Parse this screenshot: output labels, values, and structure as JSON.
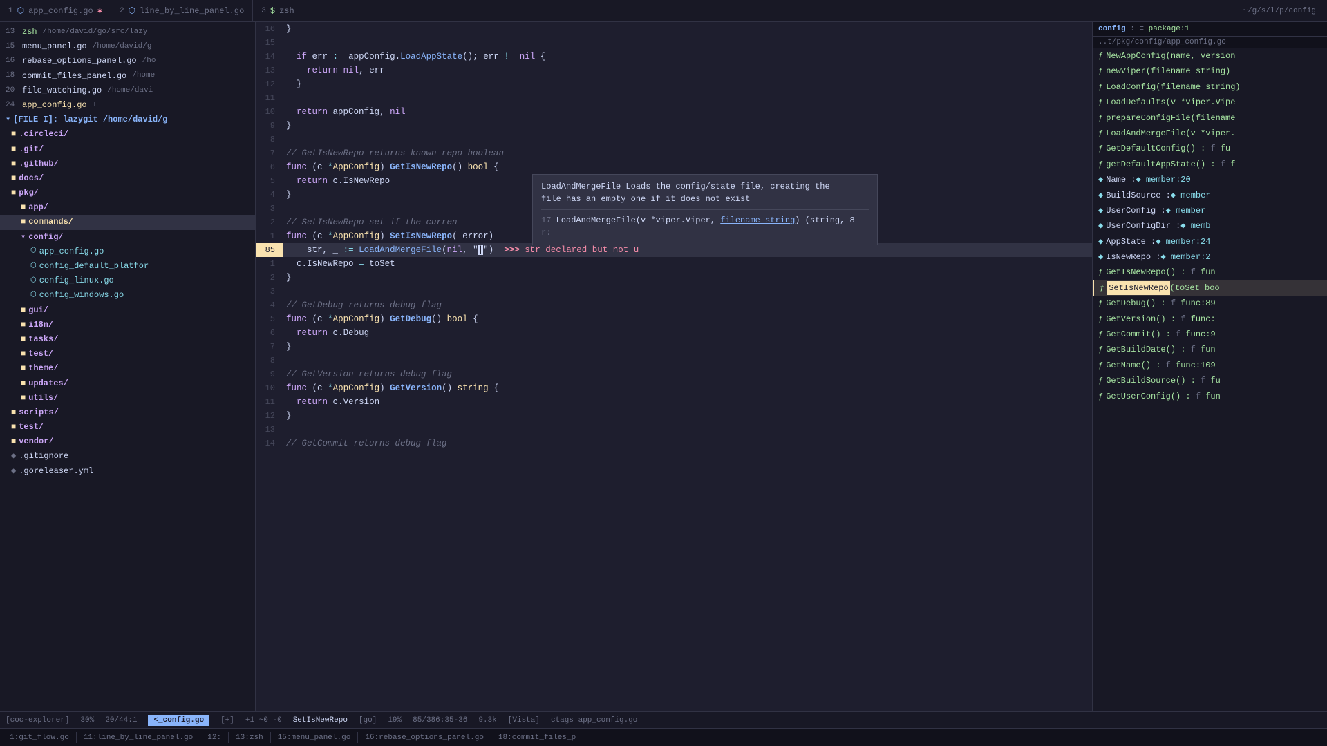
{
  "tabs": [
    {
      "num": "1",
      "icon": "go-file",
      "label": "app_config.go",
      "modified": true,
      "active": false
    },
    {
      "num": "2",
      "icon": "go-file",
      "label": "line_by_line_panel.go",
      "modified": false,
      "active": false
    },
    {
      "num": "3",
      "icon": "terminal",
      "label": "zsh",
      "modified": false,
      "active": false
    }
  ],
  "right_path": "~/g/s/l/p/config",
  "right_path2": "..t/pkg/config/app_config.go",
  "sidebar": {
    "header": "[FILE I]: lazygit /home/david/g",
    "items": [
      {
        "indent": 1,
        "type": "folder",
        "name": ".circleci/"
      },
      {
        "indent": 1,
        "type": "folder",
        "name": ".git/"
      },
      {
        "indent": 1,
        "type": "folder",
        "name": ".github/"
      },
      {
        "indent": 1,
        "type": "folder",
        "name": "docs/"
      },
      {
        "indent": 1,
        "type": "folder",
        "name": "pkg/"
      },
      {
        "indent": 2,
        "type": "folder",
        "name": "app/"
      },
      {
        "indent": 2,
        "type": "folder",
        "name": "commands/",
        "selected": true
      },
      {
        "indent": 2,
        "type": "folder-open",
        "name": "config/"
      },
      {
        "indent": 3,
        "type": "go-file",
        "name": "app_config.go"
      },
      {
        "indent": 3,
        "type": "go-file",
        "name": "config_default_platfor"
      },
      {
        "indent": 3,
        "type": "go-file",
        "name": "config_linux.go"
      },
      {
        "indent": 3,
        "type": "go-file",
        "name": "config_windows.go"
      },
      {
        "indent": 2,
        "type": "folder",
        "name": "gui/"
      },
      {
        "indent": 2,
        "type": "folder",
        "name": "i18n/"
      },
      {
        "indent": 2,
        "type": "folder",
        "name": "tasks/"
      },
      {
        "indent": 2,
        "type": "folder",
        "name": "test/"
      },
      {
        "indent": 2,
        "type": "folder",
        "name": "theme/"
      },
      {
        "indent": 2,
        "type": "folder",
        "name": "updates/"
      },
      {
        "indent": 2,
        "type": "folder",
        "name": "utils/"
      },
      {
        "indent": 1,
        "type": "folder",
        "name": "scripts/"
      },
      {
        "indent": 1,
        "type": "folder",
        "name": "test/"
      },
      {
        "indent": 1,
        "type": "folder",
        "name": "vendor/"
      },
      {
        "indent": 1,
        "type": "file",
        "name": ".gitignore"
      },
      {
        "indent": 1,
        "type": "file",
        "name": ".goreleaser.yml"
      }
    ],
    "file_list": [
      {
        "num": "13",
        "name": "zsh",
        "path": "/home/david/go/src/lazy"
      },
      {
        "num": "15",
        "name": "menu_panel.go",
        "path": "/home/david/g"
      },
      {
        "num": "16",
        "name": "rebase_options_panel.go",
        "path": "/ho"
      },
      {
        "num": "18",
        "name": "commit_files_panel.go",
        "path": "/home"
      },
      {
        "num": "20",
        "name": "file_watching.go",
        "path": "/home/davi"
      },
      {
        "num": "24",
        "name": "app_config.go",
        "path": "+"
      }
    ]
  },
  "code": {
    "lines": [
      {
        "num": "16",
        "content": "}"
      },
      {
        "num": "15",
        "content": ""
      },
      {
        "num": "14",
        "content": "  if err := appConfig.LoadAppState(); err != nil {"
      },
      {
        "num": "13",
        "content": "    return nil, err"
      },
      {
        "num": "12",
        "content": "  }"
      },
      {
        "num": "11",
        "content": ""
      },
      {
        "num": "10",
        "content": "  return appConfig, nil"
      },
      {
        "num": "9",
        "content": "}"
      },
      {
        "num": "8",
        "content": ""
      },
      {
        "num": "7",
        "content": "// GetIsNewRepo returns known repo boolean"
      },
      {
        "num": "6",
        "content": "func (c *AppConfig) GetIsNewRepo() bool {"
      },
      {
        "num": "5",
        "content": "  return c.IsNewRepo"
      },
      {
        "num": "4",
        "content": "}"
      },
      {
        "num": "3",
        "content": ""
      },
      {
        "num": "2",
        "content": "// SetIsNewRepo set if the curren"
      },
      {
        "num": "1",
        "content": "func (c *AppConfig) SetIsNewRepo( error)"
      },
      {
        "num": "85",
        "content": "  str, _ := LoadAndMergeFile(nil, \"|\")"
      },
      {
        "num": "1",
        "content": "  c.IsNewRepo = toSet"
      },
      {
        "num": "2",
        "content": "}"
      },
      {
        "num": "3",
        "content": ""
      },
      {
        "num": "4",
        "content": "// GetDebug returns debug flag"
      },
      {
        "num": "5",
        "content": "func (c *AppConfig) GetDebug() bool {"
      },
      {
        "num": "6",
        "content": "  return c.Debug"
      },
      {
        "num": "7",
        "content": "}"
      },
      {
        "num": "8",
        "content": ""
      },
      {
        "num": "9",
        "content": "// GetVersion returns debug flag"
      },
      {
        "num": "10",
        "content": "func (c *AppConfig) GetVersion() string {"
      },
      {
        "num": "11",
        "content": "  return c.Version"
      },
      {
        "num": "12",
        "content": "}"
      },
      {
        "num": "13",
        "content": ""
      },
      {
        "num": "14",
        "content": "// GetCommit returns debug flag"
      }
    ]
  },
  "tooltip": {
    "line1": "LoadAndMergeFile Loads the config/state file, creating the",
    "line2": "file has an empty one if it does not exist",
    "divider": true,
    "sig_num": "17",
    "sig": "LoadAndMergeFile(v *viper.Viper, filename string) (string, 8",
    "ret": "r:"
  },
  "outline": {
    "header": "config : ≡ package:1",
    "items": [
      {
        "type": "fn",
        "label": "NewAppConfig(name, version"
      },
      {
        "type": "fn",
        "label": "newViper(filename string)"
      },
      {
        "type": "fn",
        "label": "LoadConfig(filename string)"
      },
      {
        "type": "fn",
        "label": "LoadDefaults(v *viper.Vipe"
      },
      {
        "type": "fn",
        "label": "prepareConfigFile(filename"
      },
      {
        "type": "fn",
        "label": "LoadAndMergeFile(v *viper."
      },
      {
        "type": "fn",
        "label": "GetDefaultConfig() : f fu"
      },
      {
        "type": "fn",
        "label": "getDefaultAppState() : f f"
      },
      {
        "type": "member",
        "label": "Name : ◆ member:20"
      },
      {
        "type": "member",
        "label": "BuildSource : ◆ member"
      },
      {
        "type": "member",
        "label": "UserConfig : ◆ member"
      },
      {
        "type": "member",
        "label": "UserConfigDir : ◆ memb"
      },
      {
        "type": "member",
        "label": "AppState : ◆ member:24"
      },
      {
        "type": "member",
        "label": "IsNewRepo : ◆ member:2"
      },
      {
        "type": "fn",
        "label": "GetIsNewRepo() : f fun"
      },
      {
        "type": "fn-highlight",
        "label": "SetIsNewRepo(toSet boo"
      },
      {
        "type": "fn",
        "label": "GetDebug() : f func:89"
      },
      {
        "type": "fn",
        "label": "GetVersion() : f func:"
      },
      {
        "type": "fn",
        "label": "GetCommit() : f func:9"
      },
      {
        "type": "fn",
        "label": "GetBuildDate() : f fun"
      },
      {
        "type": "fn",
        "label": "GetName() : f func:109"
      },
      {
        "type": "fn",
        "label": "GetBuildSource() : f fu"
      },
      {
        "type": "fn",
        "label": "GetUserConfig() : f fun"
      }
    ]
  },
  "status_bar": {
    "explorer": "[coc-explorer]",
    "percent": "30%",
    "position": "20/44:1",
    "file_tab": "<_config.go",
    "modified": "[+]",
    "changes": "+1 ~0 -0",
    "func_name": "SetIsNewRepo",
    "lang": "[go]",
    "progress": "19%",
    "line_col": "85/386:35-36",
    "size": "9.3k",
    "mode": "[Vista]",
    "ctags": "ctags app_config.go"
  },
  "bottom_tabs": [
    {
      "label": "1:git_flow.go"
    },
    {
      "label": "11:line_by_line_panel.go"
    },
    {
      "label": "12:"
    },
    {
      "label": "13:zsh"
    },
    {
      "label": "15:menu_panel.go"
    },
    {
      "label": "16:rebase_options_panel.go"
    },
    {
      "label": "18:commit_files_p"
    }
  ],
  "error_msg": "str declared but not u"
}
